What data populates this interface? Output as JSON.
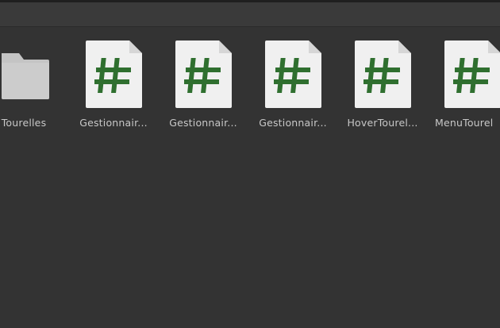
{
  "assets": [
    {
      "name": "Tourelles",
      "kind": "folder",
      "icon": "folder-icon"
    },
    {
      "name": "Gestionnair...",
      "kind": "script",
      "icon": "csharp-script-icon"
    },
    {
      "name": "Gestionnair...",
      "kind": "script",
      "icon": "csharp-script-icon"
    },
    {
      "name": "Gestionnair...",
      "kind": "script",
      "icon": "csharp-script-icon"
    },
    {
      "name": "HoverTourel...",
      "kind": "script",
      "icon": "csharp-script-icon"
    },
    {
      "name": "MenuTourel",
      "kind": "script",
      "icon": "csharp-script-icon"
    }
  ],
  "colors": {
    "background": "#333333",
    "folder": "#c4c4c4",
    "script_page": "#f0f0f0",
    "hash": "#2f6f2f",
    "label": "#c8c8c8"
  }
}
